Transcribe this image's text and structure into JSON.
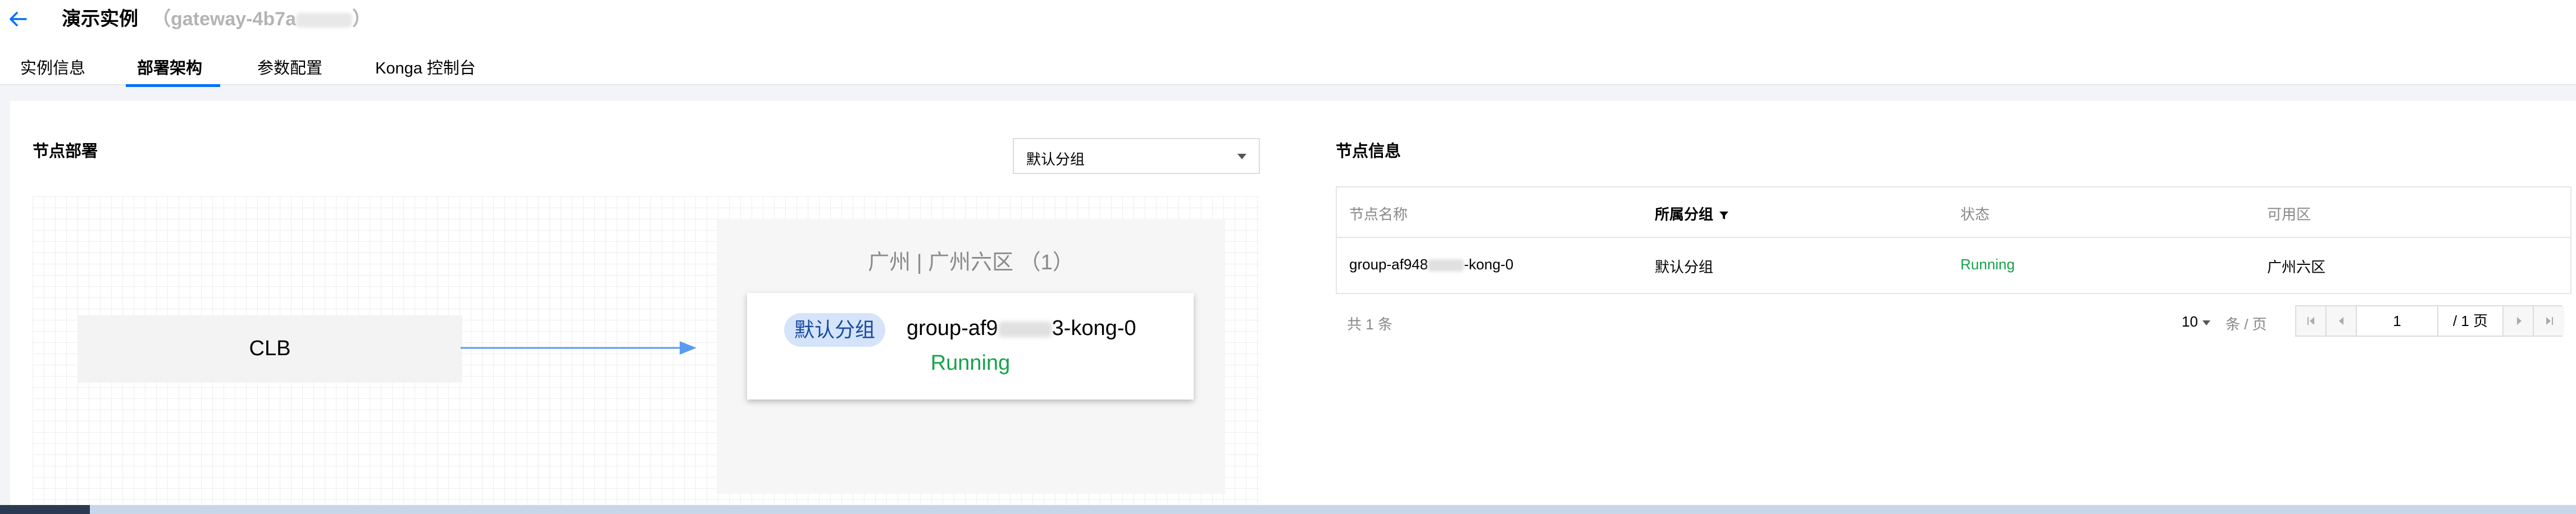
{
  "header": {
    "title": "演示实例",
    "subtitle_prefix": "（gateway-4b7a",
    "subtitle_suffix": "）"
  },
  "tabs": [
    {
      "label": "实例信息"
    },
    {
      "label": "部署架构"
    },
    {
      "label": "参数配置"
    },
    {
      "label": "Konga 控制台"
    }
  ],
  "deploy": {
    "title": "节点部署",
    "group_select": "默认分组",
    "clb_label": "CLB",
    "zone_title": "广州 | 广州六区 （1）",
    "node": {
      "group_tag": "默认分组",
      "name_prefix": "group-af9",
      "name_suffix": "3-kong-0",
      "status": "Running"
    }
  },
  "info": {
    "title": "节点信息",
    "columns": [
      "节点名称",
      "所属分组",
      "状态",
      "可用区"
    ],
    "row": {
      "name_prefix": "group-af948",
      "name_suffix": "-kong-0",
      "group": "默认分组",
      "status": "Running",
      "zone": "广州六区"
    },
    "total": "共 1 条",
    "page_size": "10",
    "per_page": "条 / 页",
    "page": "1",
    "page_total": "/ 1 页"
  },
  "colors": {
    "accent": "#006eff",
    "running": "#16a34a"
  }
}
